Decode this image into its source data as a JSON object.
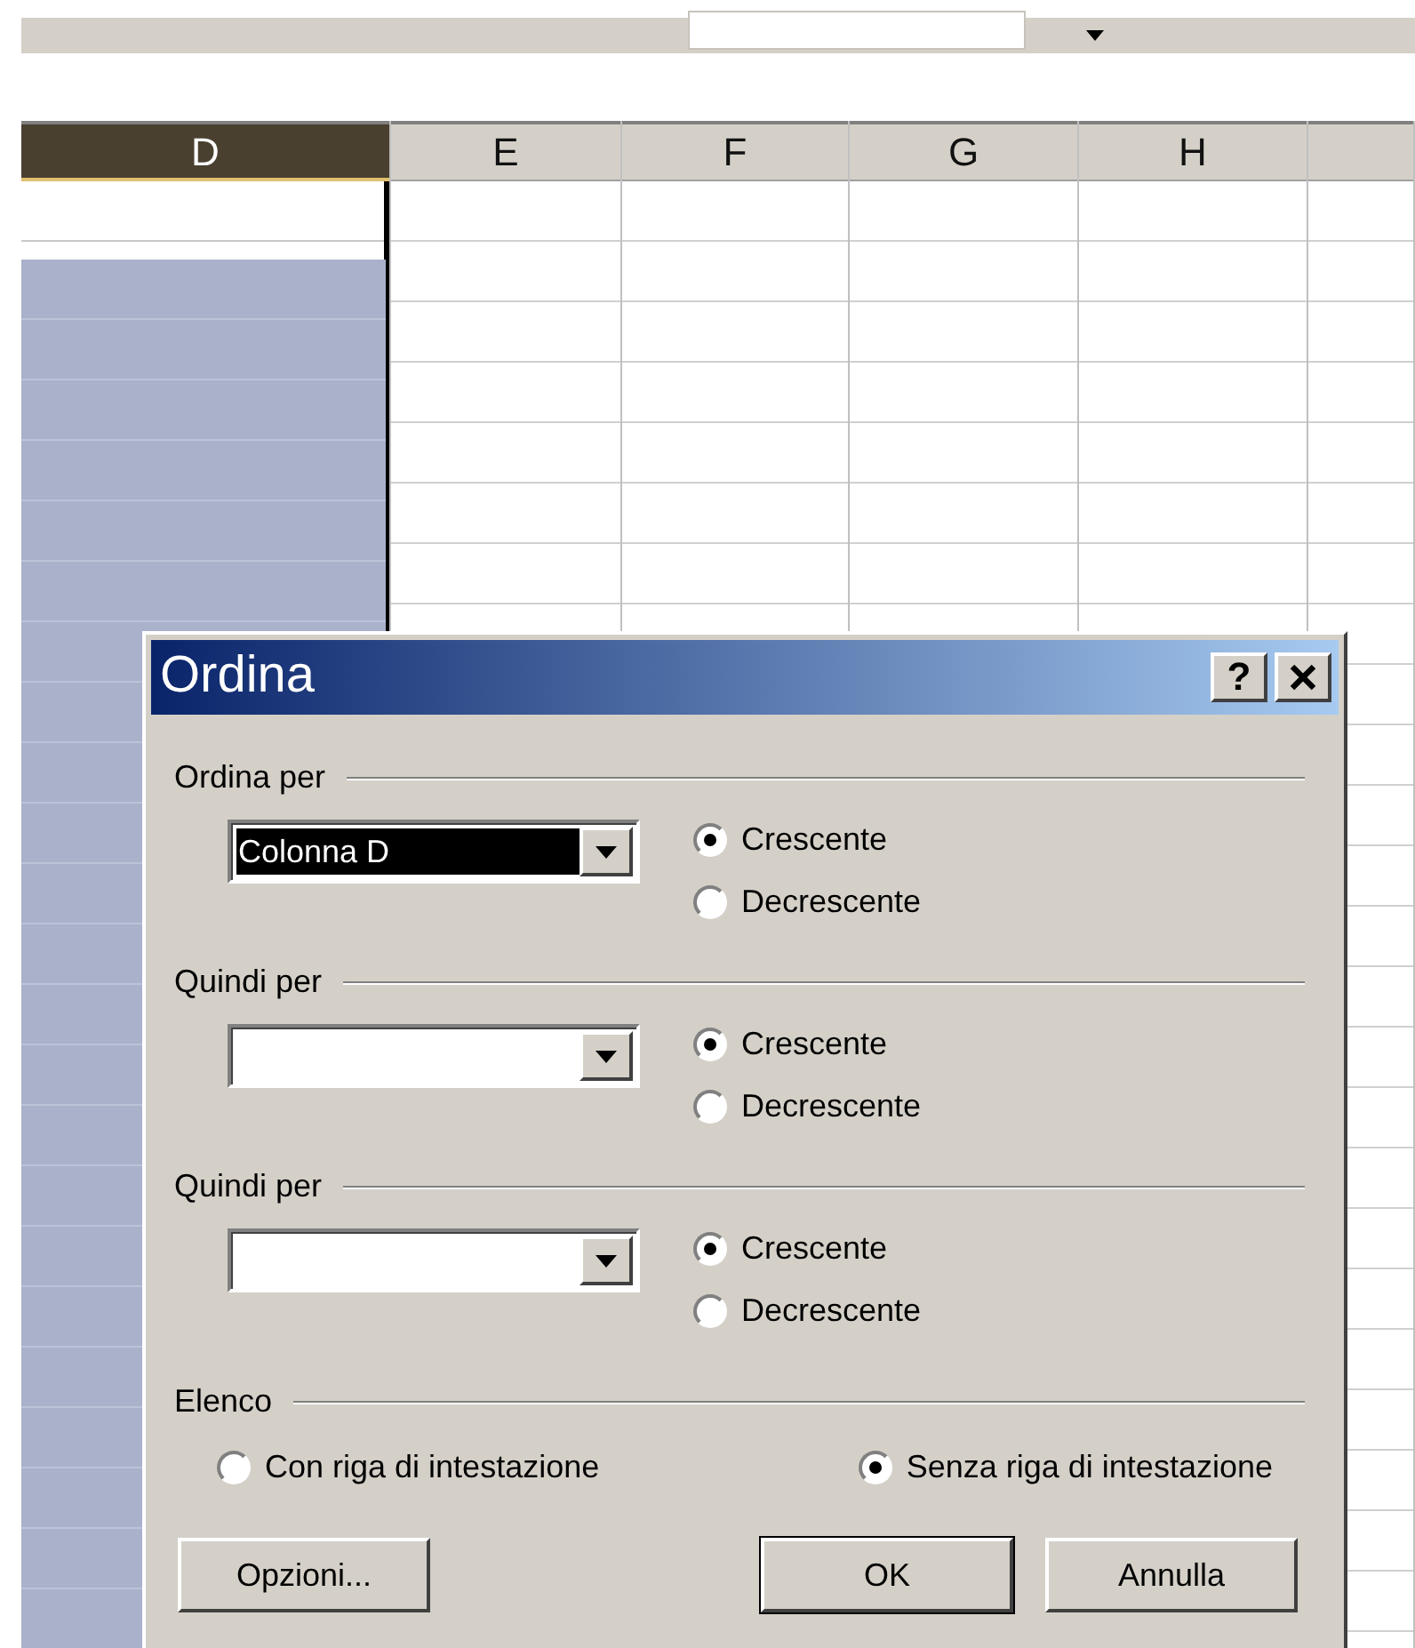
{
  "columns": [
    {
      "label": "D",
      "selected": true
    },
    {
      "label": "E",
      "selected": false
    },
    {
      "label": "F",
      "selected": false
    },
    {
      "label": "G",
      "selected": false
    },
    {
      "label": "H",
      "selected": false
    }
  ],
  "dialog": {
    "title": "Ordina",
    "help": "?",
    "sort_groups": [
      {
        "title": "Ordina per",
        "value": "Colonna D",
        "highlighted": true,
        "options": [
          {
            "label": "Crescente",
            "selected": true
          },
          {
            "label": "Decrescente",
            "selected": false
          }
        ]
      },
      {
        "title": "Quindi per",
        "highlighted": false,
        "options": [
          {
            "label": "Crescente",
            "selected": true
          },
          {
            "label": "Decrescente",
            "selected": false
          }
        ]
      },
      {
        "title": "Quindi per",
        "highlighted": false,
        "options": [
          {
            "label": "Crescente",
            "selected": true
          },
          {
            "label": "Decrescente",
            "selected": false
          }
        ]
      }
    ],
    "list_group": {
      "title": "Elenco",
      "options": [
        {
          "label": "Con riga di intestazione",
          "selected": false
        },
        {
          "label": "Senza riga di intestazione",
          "selected": true
        }
      ]
    },
    "buttons": [
      {
        "label": "Opzioni...",
        "default": false
      },
      {
        "label": "OK",
        "default": true
      },
      {
        "label": "Annulla",
        "default": false
      }
    ]
  }
}
